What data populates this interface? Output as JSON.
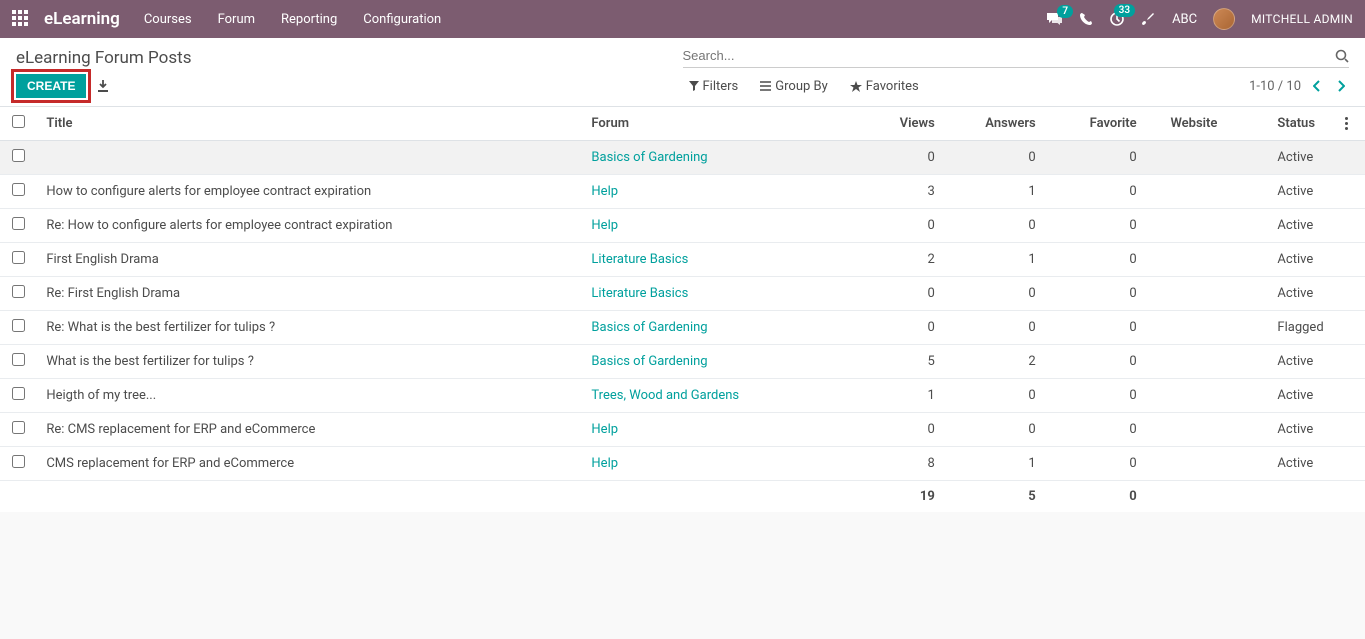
{
  "nav": {
    "brand": "eLearning",
    "menu": [
      "Courses",
      "Forum",
      "Reporting",
      "Configuration"
    ],
    "chat_badge": "7",
    "activity_badge": "33",
    "company": "ABC",
    "user": "MITCHELL ADMIN"
  },
  "breadcrumb": "eLearning Forum Posts",
  "search_placeholder": "Search...",
  "buttons": {
    "create": "Create"
  },
  "search_opts": {
    "filters": "Filters",
    "group_by": "Group By",
    "favorites": "Favorites"
  },
  "pager": "1-10 / 10",
  "columns": {
    "title": "Title",
    "forum": "Forum",
    "views": "Views",
    "answers": "Answers",
    "favorite": "Favorite",
    "website": "Website",
    "status": "Status"
  },
  "rows": [
    {
      "title": "",
      "forum": "Basics of Gardening",
      "views": "0",
      "answers": "0",
      "favorite": "0",
      "website": "",
      "status": "Active"
    },
    {
      "title": "How to configure alerts for employee contract expiration",
      "forum": "Help",
      "views": "3",
      "answers": "1",
      "favorite": "0",
      "website": "",
      "status": "Active"
    },
    {
      "title": "Re: How to configure alerts for employee contract expiration",
      "forum": "Help",
      "views": "0",
      "answers": "0",
      "favorite": "0",
      "website": "",
      "status": "Active"
    },
    {
      "title": "First English Drama",
      "forum": "Literature Basics",
      "views": "2",
      "answers": "1",
      "favorite": "0",
      "website": "",
      "status": "Active"
    },
    {
      "title": "Re: First English Drama",
      "forum": "Literature Basics",
      "views": "0",
      "answers": "0",
      "favorite": "0",
      "website": "",
      "status": "Active"
    },
    {
      "title": "Re: What is the best fertilizer for tulips ?",
      "forum": "Basics of Gardening",
      "views": "0",
      "answers": "0",
      "favorite": "0",
      "website": "",
      "status": "Flagged"
    },
    {
      "title": "What is the best fertilizer for tulips ?",
      "forum": "Basics of Gardening",
      "views": "5",
      "answers": "2",
      "favorite": "0",
      "website": "",
      "status": "Active"
    },
    {
      "title": "Heigth of my tree...",
      "forum": "Trees, Wood and Gardens",
      "views": "1",
      "answers": "0",
      "favorite": "0",
      "website": "",
      "status": "Active"
    },
    {
      "title": "Re: CMS replacement for ERP and eCommerce",
      "forum": "Help",
      "views": "0",
      "answers": "0",
      "favorite": "0",
      "website": "",
      "status": "Active"
    },
    {
      "title": "CMS replacement for ERP and eCommerce",
      "forum": "Help",
      "views": "8",
      "answers": "1",
      "favorite": "0",
      "website": "",
      "status": "Active"
    }
  ],
  "totals": {
    "views": "19",
    "answers": "5",
    "favorite": "0"
  }
}
